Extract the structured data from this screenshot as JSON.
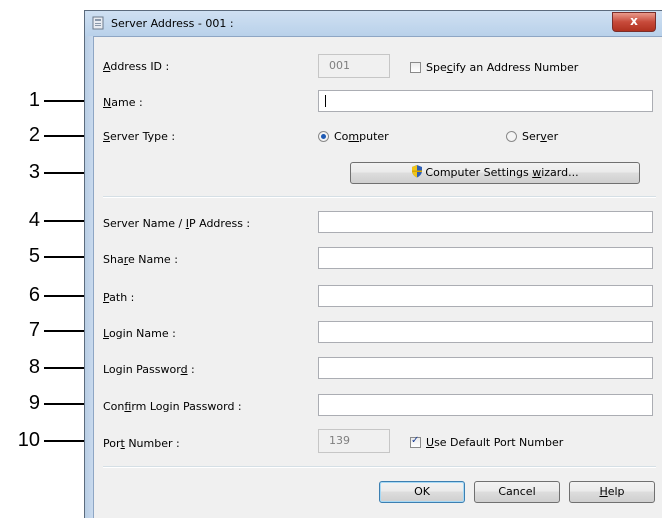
{
  "window": {
    "title": "Server Address - 001 :",
    "close_glyph": "x"
  },
  "callouts": [
    "1",
    "2",
    "3",
    "4",
    "5",
    "6",
    "7",
    "8",
    "9",
    "10"
  ],
  "form": {
    "address_id": {
      "label_pre": "",
      "label_u": "A",
      "label_post": "ddress ID :",
      "value": "001"
    },
    "specify_number": {
      "label_pre": "Spe",
      "label_u": "c",
      "label_post": "ify an Address Number",
      "checked": false
    },
    "name": {
      "label_pre": "",
      "label_u": "N",
      "label_post": "ame :",
      "value": ""
    },
    "server_type": {
      "label_pre": "",
      "label_u": "S",
      "label_post": "erver Type :",
      "computer": {
        "pre": "Co",
        "u": "m",
        "post": "puter",
        "selected": true
      },
      "server": {
        "pre": "Ser",
        "u": "v",
        "post": "er",
        "selected": false
      }
    },
    "wizard_button": {
      "pre": "Computer Settings ",
      "u": "w",
      "post": "izard..."
    },
    "server_name": {
      "label_pre": "Server Name / ",
      "label_u": "I",
      "label_post": "P Address :",
      "value": ""
    },
    "share_name": {
      "label_pre": "Sha",
      "label_u": "r",
      "label_post": "e Name :",
      "value": ""
    },
    "path": {
      "label_pre": "",
      "label_u": "P",
      "label_post": "ath :",
      "value": ""
    },
    "login_name": {
      "label_pre": "",
      "label_u": "L",
      "label_post": "ogin Name :",
      "value": ""
    },
    "login_password": {
      "label_pre": "Login Passwor",
      "label_u": "d",
      "label_post": " :",
      "value": ""
    },
    "confirm_password": {
      "label_pre": "Con",
      "label_u": "f",
      "label_post": "irm Login Password :",
      "value": ""
    },
    "port_number": {
      "label_pre": "Por",
      "label_u": "t",
      "label_post": " Number :",
      "value": "139"
    },
    "use_default_port": {
      "label_pre": "",
      "label_u": "U",
      "label_post": "se Default Port Number",
      "checked": true
    }
  },
  "buttons": {
    "ok": "OK",
    "cancel": "Cancel",
    "help": {
      "pre": "",
      "u": "H",
      "post": "elp"
    }
  }
}
